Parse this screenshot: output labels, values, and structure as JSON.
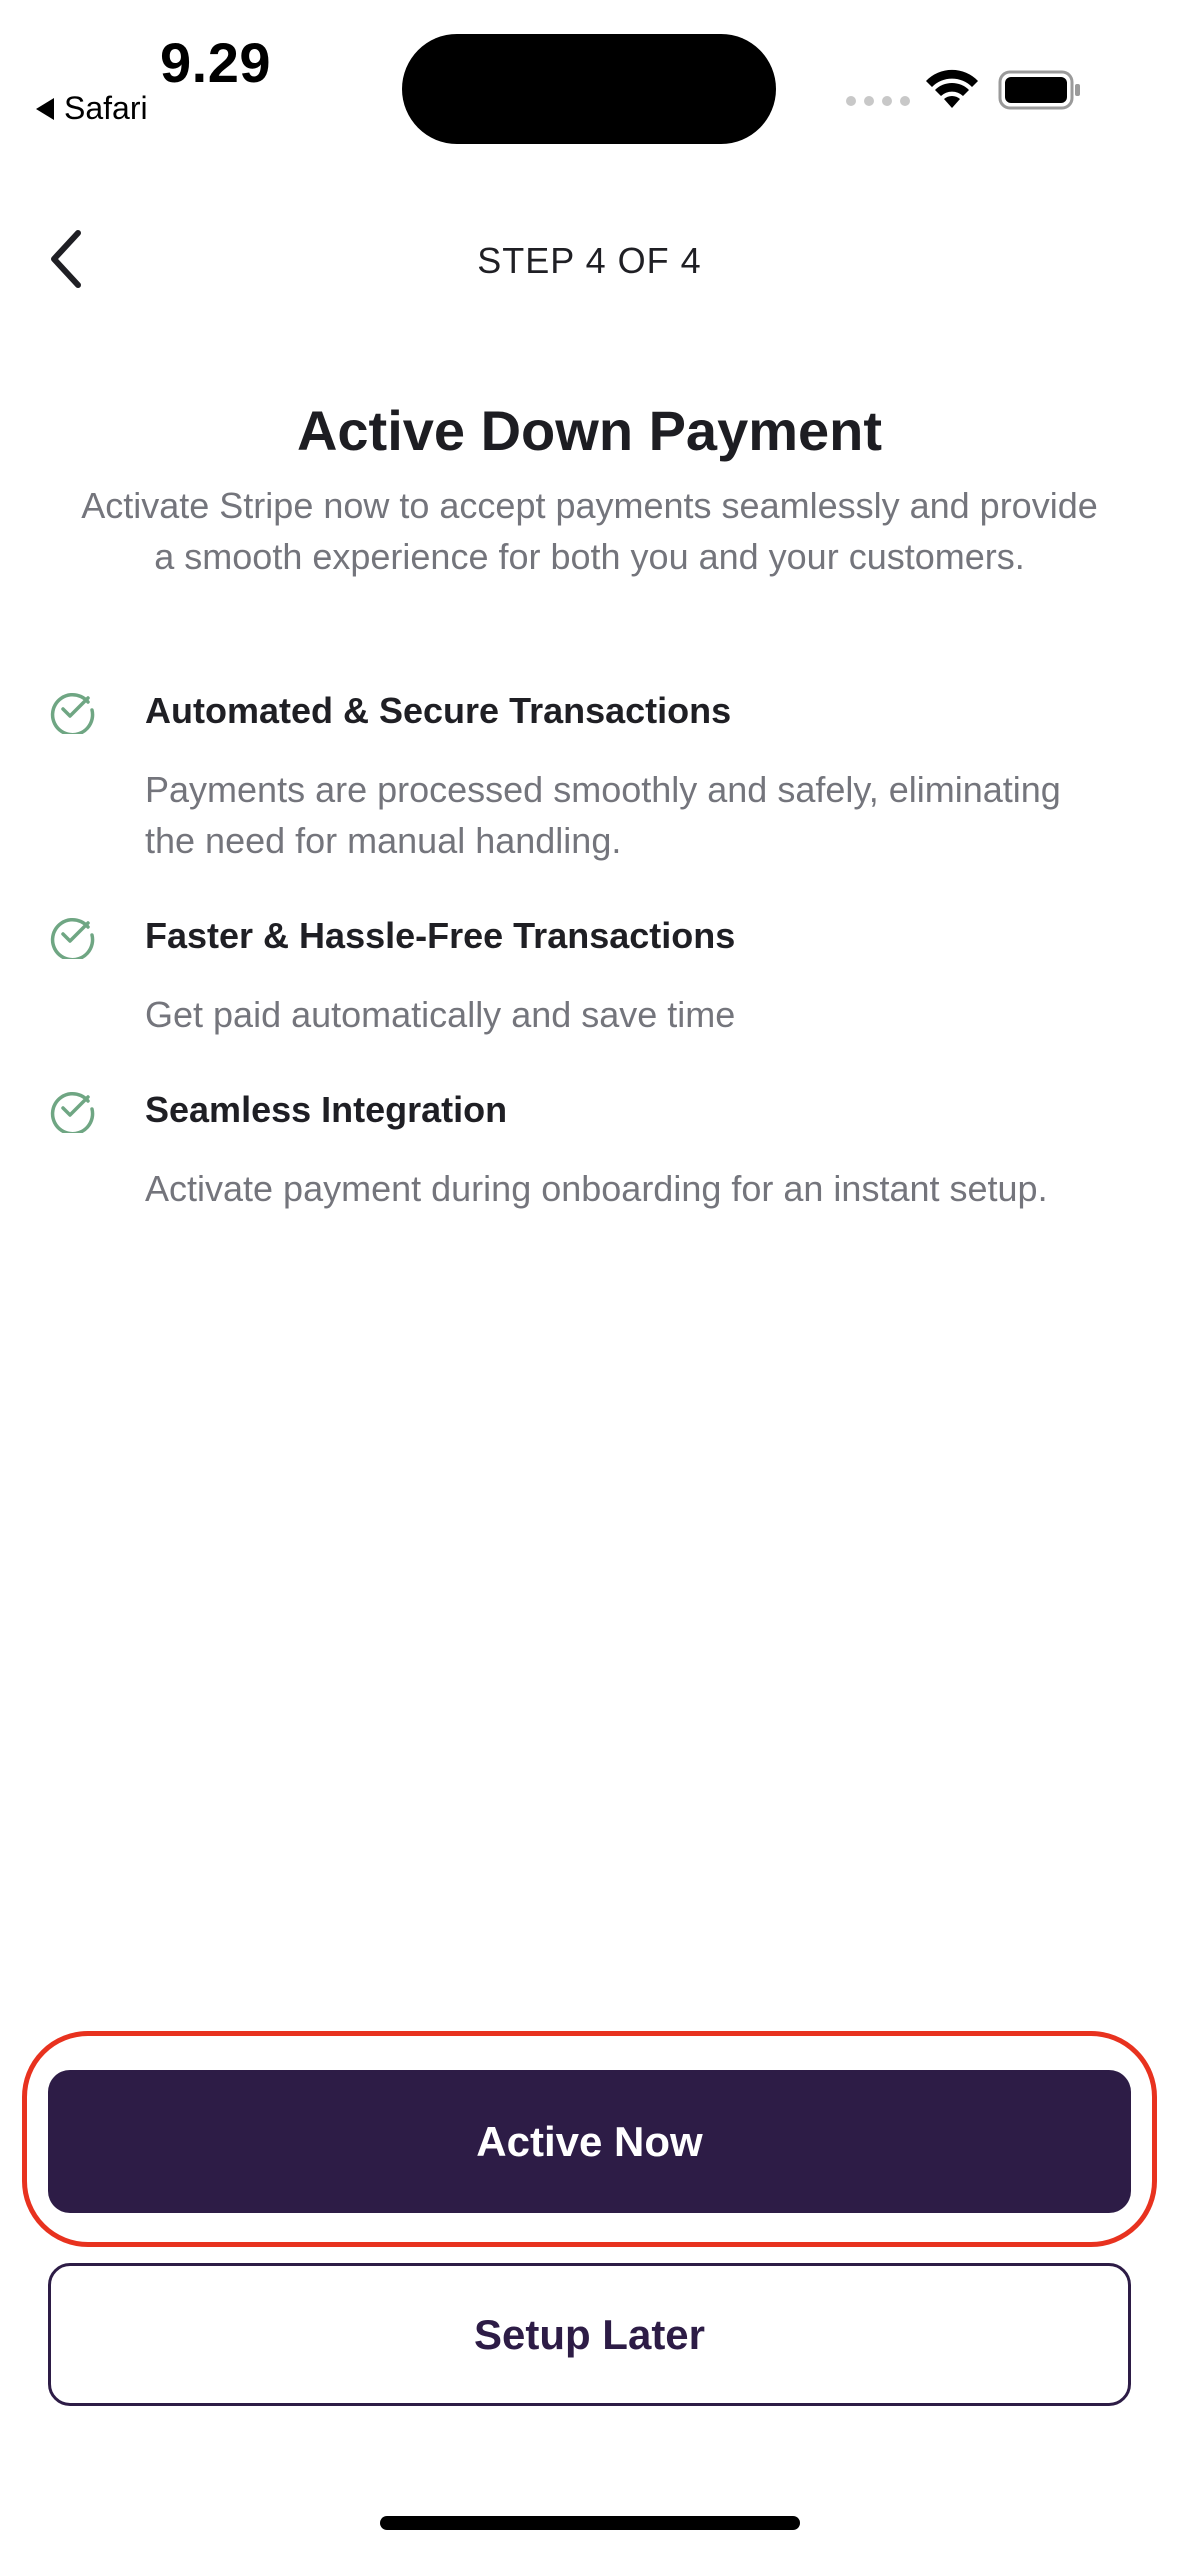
{
  "status_bar": {
    "time": "9.29",
    "back_app_label": "Safari"
  },
  "header": {
    "step_label": "STEP 4 OF 4"
  },
  "main": {
    "title": "Active Down Payment",
    "subtitle": "Activate Stripe now to accept payments seamlessly and provide a smooth experience for both you and your customers.",
    "features": [
      {
        "title": "Automated & Secure Transactions",
        "description": "Payments are processed smoothly and safely, eliminating the need for manual handling."
      },
      {
        "title": "Faster & Hassle-Free Transactions",
        "description": "Get paid automatically and save time"
      },
      {
        "title": "Seamless Integration",
        "description": "Activate payment during onboarding for an instant setup."
      }
    ]
  },
  "actions": {
    "primary_label": "Active Now",
    "secondary_label": "Setup Later"
  },
  "colors": {
    "primary": "#2d1c46",
    "check": "#6fa683",
    "highlight": "#e8321f",
    "muted_text": "#74757c"
  },
  "icons": {
    "back": "chevron-left-icon",
    "feature": "check-circle-icon"
  }
}
